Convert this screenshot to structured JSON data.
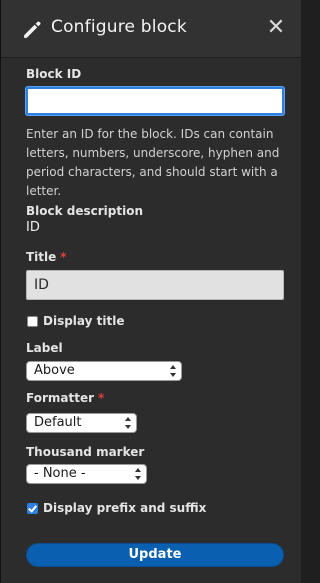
{
  "dialog": {
    "title": "Configure block",
    "close_glyph": "✕",
    "icons": {
      "header": "pencil-icon",
      "close": "close-icon"
    }
  },
  "form": {
    "block_id": {
      "label": "Block ID",
      "value": "",
      "help": "Enter an ID for the block. IDs can contain letters, numbers, underscore, hyphen and period characters, and should start with a letter."
    },
    "block_description": {
      "label": "Block description",
      "value": "ID"
    },
    "title": {
      "label": "Title",
      "required_marker": "*",
      "value": "ID"
    },
    "display_title": {
      "label": "Display title",
      "checked": false
    },
    "label": {
      "label": "Label",
      "selected": "Above"
    },
    "formatter": {
      "label": "Formatter",
      "required_marker": "*",
      "selected": "Default"
    },
    "thousand_marker": {
      "label": "Thousand marker",
      "selected": "- None -"
    },
    "prefix_suffix": {
      "label": "Display prefix and suffix",
      "checked": true
    },
    "submit_label": "Update"
  },
  "colors": {
    "panel_bg": "#2c2c2c",
    "accent": "#2f7fe0",
    "button_bg": "#0a5fb0",
    "required": "#e23f3f"
  }
}
